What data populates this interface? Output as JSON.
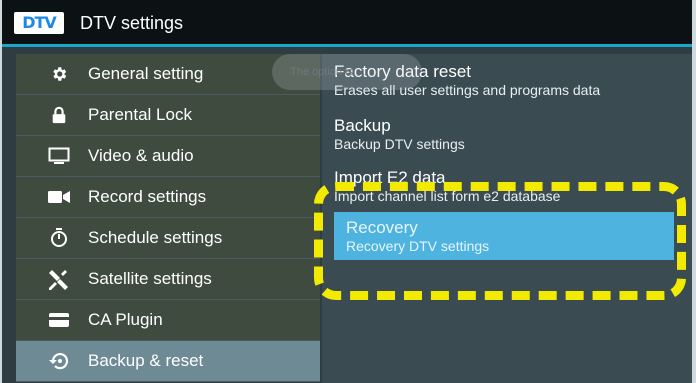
{
  "window": {
    "logo_text": "DTV",
    "title": "DTV settings"
  },
  "toast": {
    "text": "The option is ..."
  },
  "sidebar": {
    "items": [
      {
        "label": "General setting",
        "icon": "gear-icon"
      },
      {
        "label": "Parental Lock",
        "icon": "lock-icon"
      },
      {
        "label": "Video & audio",
        "icon": "monitor-icon"
      },
      {
        "label": "Record settings",
        "icon": "video-camera-icon"
      },
      {
        "label": "Schedule settings",
        "icon": "timer-icon"
      },
      {
        "label": "Satellite settings",
        "icon": "satellite-icon"
      },
      {
        "label": "CA Plugin",
        "icon": "card-icon"
      },
      {
        "label": "Backup & reset",
        "icon": "restore-icon",
        "active": true
      }
    ]
  },
  "options": [
    {
      "title": "Factory data reset",
      "subtitle": "Erases all user settings and programs data"
    },
    {
      "title": "Backup",
      "subtitle": "Backup DTV settings"
    },
    {
      "title": "Import E2 data",
      "subtitle": "Import channel list form e2 database"
    },
    {
      "title": "Recovery",
      "subtitle": "Recovery DTV settings",
      "selected": true
    }
  ],
  "colors": {
    "accent": "#1aa7c9",
    "selected": "#4fb3e0",
    "highlight": "#f2ea00",
    "sidebar_active": "#6d8a95"
  }
}
